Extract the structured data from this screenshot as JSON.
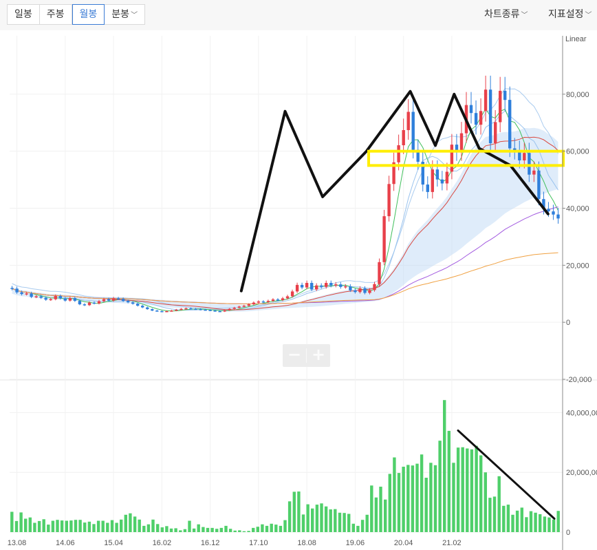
{
  "tabs": [
    {
      "label": "일봉",
      "active": false
    },
    {
      "label": "주봉",
      "active": false
    },
    {
      "label": "월봉",
      "active": true
    },
    {
      "label": "분봉",
      "active": false,
      "dropdown": true
    }
  ],
  "menu": {
    "chart_type": "차트종류",
    "indicator_settings": "지표설정"
  },
  "zoom": {
    "minus": "−",
    "plus": "+"
  },
  "colors": {
    "up": "#e8404a",
    "down": "#2f7fdb",
    "volume": "#4fcf6a",
    "cloud": "#b8d4f5",
    "cloud_red": "#e86a6a",
    "annotation": "#111111",
    "highlight_box": "#ffee00",
    "accent": "#3a7bd5"
  },
  "chart_data": [
    {
      "type": "candlestick",
      "scale": "Linear",
      "ylim": [
        -20000,
        100000
      ],
      "y_ticks": [
        "80,000",
        "60,000",
        "40,000",
        "20,000",
        "0",
        "-20,000"
      ],
      "y_tick_values": [
        80000,
        60000,
        40000,
        20000,
        0,
        -20000
      ],
      "x_ticks": [
        "13.08",
        "14.06",
        "15.04",
        "16.02",
        "16.12",
        "17.10",
        "18.08",
        "19.06",
        "20.04",
        "21.02"
      ],
      "grid": true,
      "series": [
        {
          "name": "price",
          "close": [
            11800,
            10500,
            9900,
            10100,
            8900,
            9100,
            8600,
            7900,
            8100,
            9200,
            8400,
            7600,
            8500,
            7500,
            6300,
            6000,
            6900,
            6600,
            7400,
            8100,
            7600,
            8400,
            8200,
            7500,
            7000,
            6500,
            5800,
            5200,
            4600,
            4100,
            3900,
            3700,
            3900,
            4100,
            4400,
            4700,
            4900,
            4700,
            4600,
            4400,
            4300,
            4100,
            3900,
            3800,
            4200,
            4700,
            5100,
            5500,
            5800,
            6300,
            6900,
            7300,
            7100,
            7500,
            8000,
            7800,
            8400,
            9100,
            10800,
            13100,
            12200,
            13800,
            11500,
            12900,
            12400,
            13800,
            12900,
            13300,
            12400,
            12600,
            11200,
            10600,
            11900,
            10300,
            11300,
            13400,
            21100,
            37200,
            48500,
            56100,
            62100,
            67400,
            73800,
            60500,
            56300,
            48300,
            45700,
            53600,
            50100,
            48700,
            52800,
            62300,
            59600,
            66300,
            76200,
            73400,
            69300,
            74100,
            81600,
            62800,
            70200,
            81200,
            78000,
            61000,
            60100,
            56800,
            59400,
            51800,
            53200,
            43200,
            39800,
            38900,
            37800,
            36400
          ]
        }
      ]
    },
    {
      "type": "bar",
      "name": "volume",
      "ylim": [
        0,
        50000000
      ],
      "y_ticks": [
        "40,000,000",
        "20,000,000",
        "0"
      ],
      "y_tick_values": [
        40000000,
        20000000,
        0
      ],
      "values": [
        6800000,
        3700000,
        6600000,
        4500000,
        4900000,
        3100000,
        3700000,
        4300000,
        2500000,
        3800000,
        4100000,
        3900000,
        3800000,
        3900000,
        4100000,
        4100000,
        3200000,
        3500000,
        2700000,
        3800000,
        3800000,
        3100000,
        4000000,
        3100000,
        4200000,
        5800000,
        6300000,
        5200000,
        4200000,
        2100000,
        2600000,
        4200000,
        2700000,
        1600000,
        2000000,
        1200000,
        1300000,
        600000,
        1000000,
        3800000,
        1200000,
        2600000,
        1700000,
        1400000,
        1400000,
        1100000,
        1400000,
        2100000,
        1100000,
        500000,
        600000,
        300000,
        400000,
        1400000,
        1800000,
        2600000,
        2100000,
        2800000,
        2500000,
        2100000,
        4000000,
        10300000,
        13500000,
        13600000,
        5900000,
        9300000,
        7900000,
        9200000,
        9600000,
        8600000,
        7600000,
        7700000,
        6500000,
        6400000,
        6100000,
        2800000,
        2100000,
        4100000,
        5800000,
        15600000,
        11600000,
        15200000,
        10900000,
        19500000,
        25000000,
        19800000,
        21900000,
        22500000,
        22300000,
        22900000,
        26000000,
        18200000,
        23200000,
        22400000,
        30600000,
        44200000,
        33900000,
        23200000,
        28300000,
        28400000,
        28000000,
        27700000,
        28900000,
        25700000,
        20000000,
        11500000,
        11900000,
        18700000,
        8800000,
        9200000,
        5800000,
        7200000,
        8200000,
        5000000,
        7000000,
        6500000,
        6000000,
        5200000,
        4900000,
        4200000,
        7100000
      ]
    }
  ]
}
